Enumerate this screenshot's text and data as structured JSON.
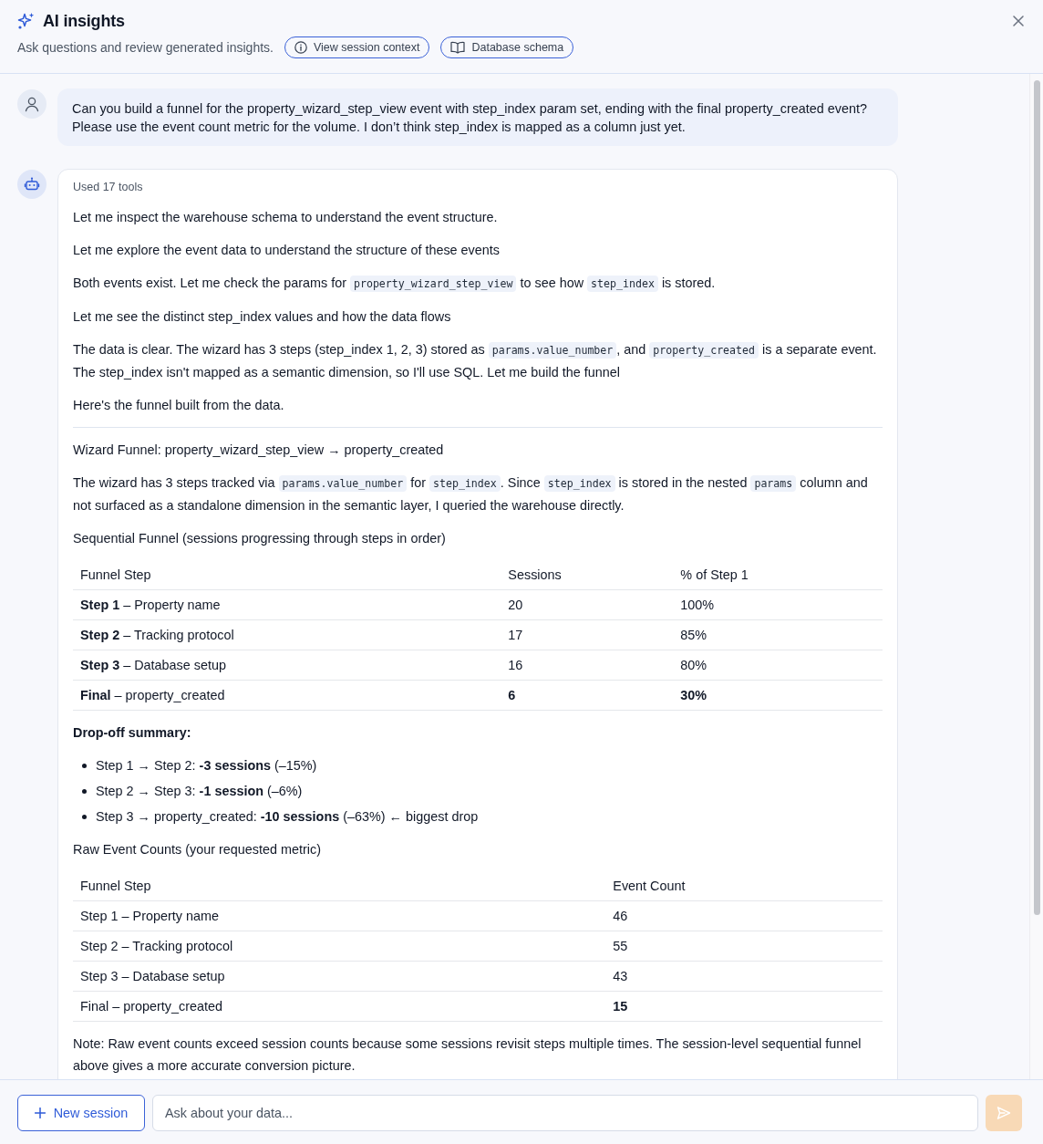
{
  "header": {
    "title": "AI insights",
    "subtitle": "Ask questions and review generated insights.",
    "actions": [
      {
        "label": "View session context",
        "kind": "info"
      },
      {
        "label": "Database schema",
        "kind": "book"
      }
    ]
  },
  "messages": [
    {
      "kind": "user",
      "text": "Can you build a funnel for the property_wizard_step_view event with step_index param set, ending with the final property_created event? Please use the event count metric for the volume. I don’t think step_index is mapped as a column just yet."
    },
    {
      "kind": "assistant",
      "tools_used": "Used 17 tools",
      "steps": [
        {
          "parts": [
            {
              "kind": "text",
              "text": "Let me inspect the warehouse schema to understand the event structure."
            }
          ]
        },
        {
          "parts": [
            {
              "kind": "text",
              "text": "Let me explore the event data to understand the structure of these events"
            }
          ]
        },
        {
          "parts": [
            {
              "kind": "text",
              "text": "Both events exist. Let me check the params for "
            },
            {
              "kind": "code",
              "text": "property_wizard_step_view"
            },
            {
              "kind": "text",
              "text": " to see how "
            },
            {
              "kind": "code",
              "text": "step_index"
            },
            {
              "kind": "text",
              "text": " is stored."
            }
          ]
        },
        {
          "parts": [
            {
              "kind": "text",
              "text": "Let me see the distinct step_index values and how the data flows"
            }
          ]
        },
        {
          "parts": [
            {
              "kind": "text",
              "text": "The data is clear. The wizard has 3 steps (step_index 1, 2, 3) stored as "
            },
            {
              "kind": "code",
              "text": "params.value_number"
            },
            {
              "kind": "text",
              "text": ", and "
            },
            {
              "kind": "code",
              "text": "property_created"
            },
            {
              "kind": "text",
              "text": " is a separate event. The step_index isn't mapped as a semantic dimension, so I'll use SQL. Let me build the funnel"
            }
          ]
        },
        {
          "parts": [
            {
              "kind": "text",
              "text": "Here's the funnel built from the data."
            }
          ]
        }
      ],
      "answer": [
        {
          "kind": "paragraph",
          "parts": [
            {
              "kind": "text",
              "text": "Wizard Funnel: property_wizard_step_view → property_created"
            }
          ]
        },
        {
          "kind": "paragraph",
          "parts": [
            {
              "kind": "text",
              "text": "The wizard has 3 steps tracked via "
            },
            {
              "kind": "code",
              "text": "params.value_number"
            },
            {
              "kind": "text",
              "text": " for "
            },
            {
              "kind": "code",
              "text": "step_index"
            },
            {
              "kind": "text",
              "text": ". Since "
            },
            {
              "kind": "code",
              "text": "step_index"
            },
            {
              "kind": "text",
              "text": " is stored in the nested "
            },
            {
              "kind": "code",
              "text": "params"
            },
            {
              "kind": "text",
              "text": " column and not surfaced as a standalone dimension in the semantic layer, I queried the warehouse directly."
            }
          ]
        },
        {
          "kind": "paragraph",
          "parts": [
            {
              "kind": "text",
              "text": "Sequential Funnel (sessions progressing through steps in order)"
            }
          ]
        },
        {
          "kind": "table",
          "columns": [
            "Funnel Step",
            "Sessions",
            "% of Step 1"
          ],
          "rows": [
            {
              "cells": [
                {
                  "text": "**Step 1** – Property name",
                  "bold": false
                },
                {
                  "text": "20",
                  "bold": false
                },
                {
                  "text": "100%",
                  "bold": false
                }
              ]
            },
            {
              "cells": [
                {
                  "text": "**Step 2** – Tracking protocol",
                  "bold": false
                },
                {
                  "text": "17",
                  "bold": false
                },
                {
                  "text": "85%",
                  "bold": false
                }
              ]
            },
            {
              "cells": [
                {
                  "text": "**Step 3** – Database setup",
                  "bold": false
                },
                {
                  "text": "16",
                  "bold": false
                },
                {
                  "text": "80%",
                  "bold": false
                }
              ]
            },
            {
              "cells": [
                {
                  "text": "**Final** – property_created",
                  "bold": false
                },
                {
                  "text": "6",
                  "bold": true
                },
                {
                  "text": "30%",
                  "bold": true
                }
              ]
            }
          ]
        },
        {
          "kind": "heading",
          "text": "Drop-off summary:"
        },
        {
          "kind": "list",
          "items": [
            "Step 1 → Step 2: **-3 sessions** (–15%)",
            "Step 2 → Step 3: **-1 session** (–6%)",
            "Step 3 → property_created: **-10 sessions** (–63%) ← biggest drop"
          ]
        },
        {
          "kind": "paragraph",
          "parts": [
            {
              "kind": "text",
              "text": "Raw Event Counts (your requested metric)"
            }
          ]
        },
        {
          "kind": "table",
          "columns": [
            "Funnel Step",
            "Event Count"
          ],
          "rows": [
            {
              "cells": [
                {
                  "text": "Step 1 – Property name",
                  "bold": false
                },
                {
                  "text": "46",
                  "bold": false
                }
              ]
            },
            {
              "cells": [
                {
                  "text": "Step 2 – Tracking protocol",
                  "bold": false
                },
                {
                  "text": "55",
                  "bold": false
                }
              ]
            },
            {
              "cells": [
                {
                  "text": "Step 3 – Database setup",
                  "bold": false
                },
                {
                  "text": "43",
                  "bold": false
                }
              ]
            },
            {
              "cells": [
                {
                  "text": "Final – property_created",
                  "bold": false
                },
                {
                  "text": "15",
                  "bold": true
                }
              ]
            }
          ]
        },
        {
          "kind": "paragraph",
          "parts": [
            {
              "kind": "text",
              "text": "Note: Raw event counts exceed session counts because some sessions revisit steps multiple times. The session-level sequential funnel above gives a more accurate conversion picture."
            }
          ]
        }
      ]
    }
  ],
  "footer": {
    "new_session": "New session",
    "input": {
      "placeholder": "Ask about your data..."
    },
    "send": {
      "disabled": true
    }
  }
}
